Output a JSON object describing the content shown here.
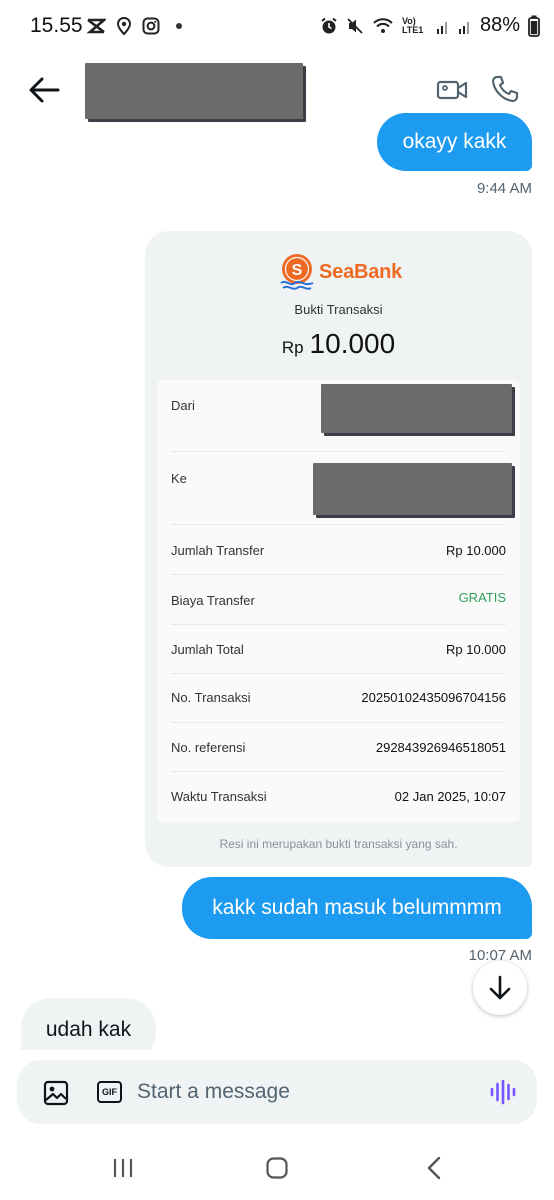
{
  "status_bar": {
    "time": "15.55",
    "battery": "88%",
    "network": "Vo) LTE1"
  },
  "header": {
    "icons": [
      "back-arrow-icon",
      "video-camera-icon",
      "phone-icon"
    ]
  },
  "messages": [
    {
      "direction": "sent",
      "text": "okayy kakk",
      "time": "9:44 AM"
    },
    {
      "direction": "sent",
      "type": "receipt",
      "time": ""
    },
    {
      "direction": "sent",
      "text": "kakk sudah masuk belummmm",
      "time": "10:07 AM"
    },
    {
      "direction": "received",
      "text": "udah kak"
    }
  ],
  "receipt": {
    "brand": "SeaBank",
    "logo_letter": "S",
    "subtitle": "Bukti Transaksi",
    "currency": "Rp",
    "amount": "10.000",
    "rows": [
      {
        "label": "Dari",
        "value": ""
      },
      {
        "label": "Ke",
        "value": ""
      },
      {
        "label": "Jumlah Transfer",
        "value": "Rp 10.000"
      },
      {
        "label": "Biaya Transfer",
        "value": "GRATIS"
      },
      {
        "label": "Jumlah Total",
        "value": "Rp 10.000"
      },
      {
        "label": "No. Transaksi",
        "value": "20250102435096704156"
      },
      {
        "label": "No. referensi",
        "value": "292843926946518051"
      },
      {
        "label": "Waktu Transaksi",
        "value": "02 Jan 2025, 10:07"
      }
    ],
    "footer": "Resi ini merupakan bukti transaksi yang sah.",
    "colors": {
      "brand": "#ee6a23",
      "free": "#2ea35b"
    }
  },
  "composer": {
    "placeholder": "Start a message",
    "gif_label": "GIF"
  },
  "colors": {
    "accent": "#1d9bf0",
    "voice": "#7856ff"
  }
}
